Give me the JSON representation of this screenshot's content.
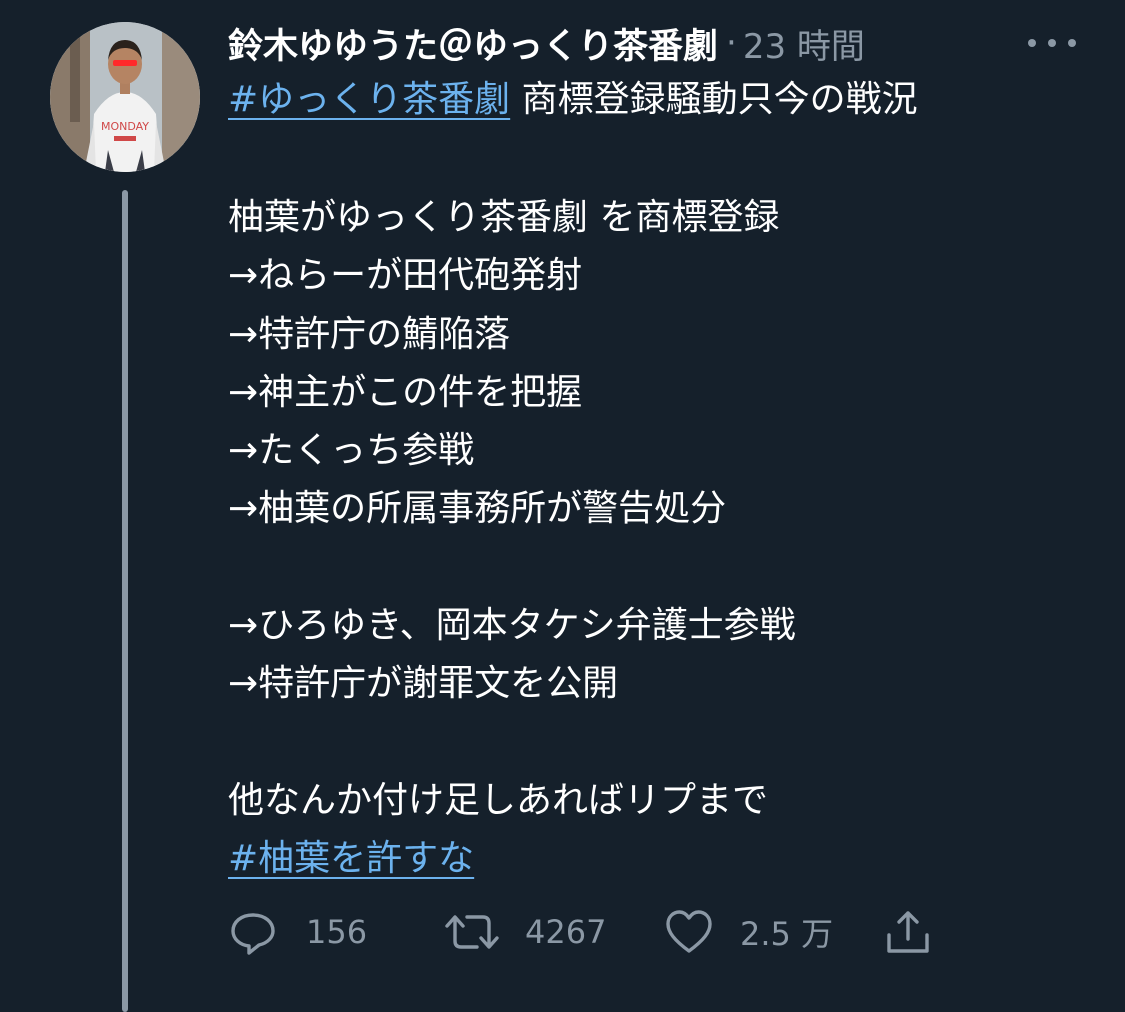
{
  "tweet": {
    "author_name": "鈴木ゆゆうた＠ゆっくり茶番劇",
    "separator": "·",
    "time_ago": "23 時間",
    "lines": [
      {
        "hashtag": "#ゆっくり茶番劇",
        "text": " 商標登録騒動只今の戦況"
      },
      {
        "text": "柚葉がゆっくり茶番劇 を商標登録"
      },
      {
        "text": "→ねらーが田代砲発射"
      },
      {
        "text": "→特許庁の鯖陥落"
      },
      {
        "text": "→神主がこの件を把握"
      },
      {
        "text": "→たくっち参戦"
      },
      {
        "text": "→柚葉の所属事務所が警告処分"
      },
      {
        "text": "→ひろゆき、岡本タケシ弁護士参戦"
      },
      {
        "text": "→特許庁が謝罪文を公開"
      },
      {
        "text": "他なんか付け足しあればリプまで"
      },
      {
        "hashtag": "#柚葉を許すな"
      }
    ]
  },
  "actions": {
    "reply_icon": "reply-icon",
    "reply_count": "156",
    "retweet_icon": "retweet-icon",
    "retweet_count": "4267",
    "like_icon": "heart-icon",
    "like_count": "2.5 万",
    "share_icon": "share-icon"
  },
  "colors": {
    "background": "#15202b",
    "text": "#ffffff",
    "muted": "#8b98a5",
    "link": "#6cb2ee"
  }
}
